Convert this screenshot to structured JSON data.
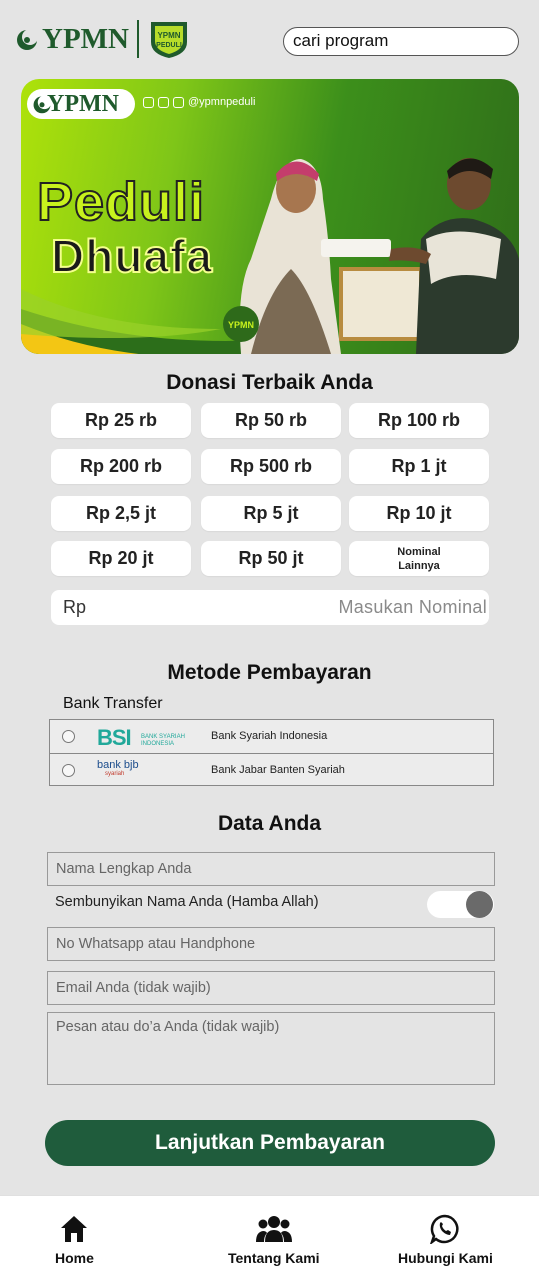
{
  "header": {
    "logo_text": "YPMN",
    "badge_text": "YPMN PEDULI",
    "search_placeholder": "cari program"
  },
  "banner": {
    "logo_text": "YPMN",
    "social_handle": "@ypmnpeduli",
    "headline_line1": "Peduli",
    "headline_line2": "Dhuafa"
  },
  "donation": {
    "title": "Donasi Terbaik Anda",
    "amounts": [
      "Rp 25 rb",
      "Rp 50 rb",
      "Rp 100 rb",
      "Rp 200 rb",
      "Rp 500 rb",
      "Rp 1 jt",
      "Rp 2,5 jt",
      "Rp 5 jt",
      "Rp 10 jt",
      "Rp 20 jt",
      "Rp 50 jt"
    ],
    "other_line1": "Nominal",
    "other_line2": "Lainnya",
    "nominal_prefix": "Rp",
    "nominal_placeholder": "Masukan Nominal"
  },
  "payment": {
    "title": "Metode Pembayaran",
    "category": "Bank Transfer",
    "banks": [
      {
        "logo": "BSI",
        "logo_sub": "BANK SYARIAH INDONESIA",
        "name": "Bank Syariah Indonesia"
      },
      {
        "logo": "bank bjb",
        "logo_sub": "syariah",
        "name": "Bank Jabar Banten Syariah"
      }
    ]
  },
  "form": {
    "title": "Data Anda",
    "name_placeholder": "Nama Lengkap Anda",
    "hide_name_label": "Sembunyikan Nama Anda (Hamba Allah)",
    "phone_placeholder": "No Whatsapp atau Handphone",
    "email_placeholder": "Email Anda (tidak wajib)",
    "message_placeholder": "Pesan atau do’a Anda (tidak wajib)",
    "submit_label": "Lanjutkan Pembayaran"
  },
  "nav": {
    "items": [
      {
        "label": "Home",
        "icon": "home-icon"
      },
      {
        "label": "Tentang Kami",
        "icon": "people-icon"
      },
      {
        "label": "Hubungi Kami",
        "icon": "whatsapp-icon"
      }
    ]
  },
  "colors": {
    "brand_green": "#1f5a2c",
    "button_green": "#1f5c3c",
    "banner_lime": "#c8f21d",
    "bsi_teal": "#21a89a",
    "background": "#e4e4e4"
  }
}
